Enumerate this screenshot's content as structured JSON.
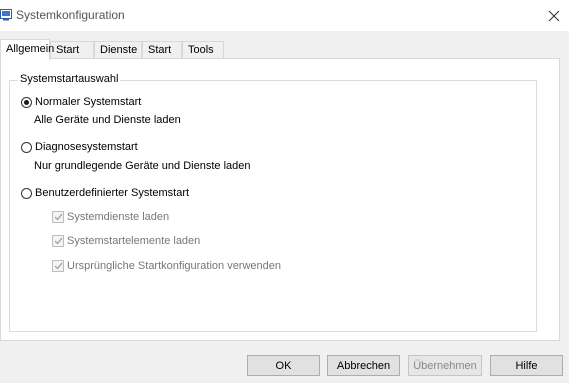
{
  "window": {
    "title": "Systemkonfiguration",
    "app_icon": "msconfig-icon",
    "close_icon": "close-icon"
  },
  "tabs": [
    {
      "label": "Allgemein",
      "active": true
    },
    {
      "label": "Start",
      "active": false
    },
    {
      "label": "Dienste",
      "active": false
    },
    {
      "label": "Start",
      "active": false
    },
    {
      "label": "Tools",
      "active": false
    }
  ],
  "startup": {
    "group_title": "Systemstartauswahl",
    "options": [
      {
        "label": "Normaler Systemstart",
        "description": "Alle Geräte und Dienste laden",
        "selected": true
      },
      {
        "label": "Diagnosesystemstart",
        "description": "Nur grundlegende Geräte und Dienste laden",
        "selected": false
      },
      {
        "label": "Benutzerdefinierter Systemstart",
        "selected": false
      }
    ],
    "custom_checks": [
      {
        "label": "Systemdienste laden",
        "checked": true,
        "enabled": false
      },
      {
        "label": "Systemstartelemente laden",
        "checked": true,
        "enabled": false
      },
      {
        "label": "Ursprüngliche Startkonfiguration verwenden",
        "checked": true,
        "enabled": false
      }
    ]
  },
  "buttons": {
    "ok": "OK",
    "cancel": "Abbrechen",
    "apply": "Übernehmen",
    "help": "Hilfe"
  }
}
